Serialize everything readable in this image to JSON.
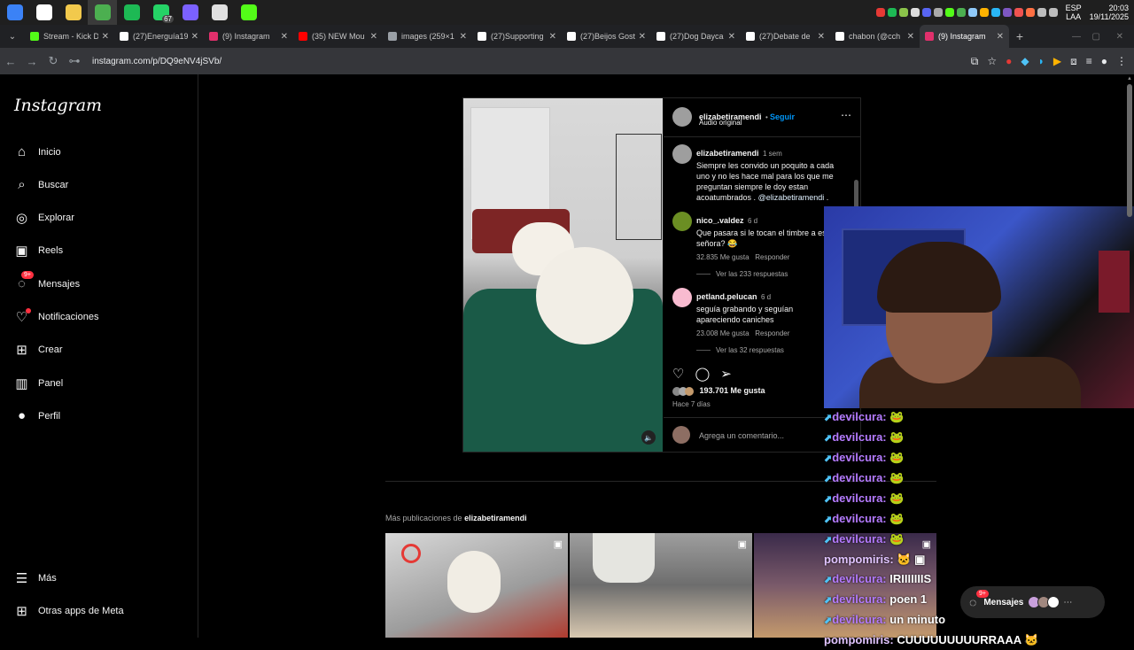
{
  "taskbar": {
    "apps": [
      {
        "name": "windows-start",
        "color": "#3b82f6"
      },
      {
        "name": "search",
        "color": "#ffffff"
      },
      {
        "name": "file-explorer",
        "color": "#f2c94c"
      },
      {
        "name": "chrome",
        "color": "#4caf50"
      },
      {
        "name": "spotify",
        "color": "#1db954"
      },
      {
        "name": "whatsapp",
        "color": "#25d366",
        "badge": "67"
      },
      {
        "name": "messenger",
        "color": "#7b61ff"
      },
      {
        "name": "chatgpt",
        "color": "#e0e0e0"
      },
      {
        "name": "kick",
        "color": "#53fc18"
      }
    ],
    "lang": "ESP",
    "lang_sub": "LAA",
    "time": "20:03",
    "date": "19/11/2025"
  },
  "tabs": [
    {
      "label": "Stream - Kick D",
      "color": "#53fc18"
    },
    {
      "label": "(27)Energuía19",
      "color": "#ffffff"
    },
    {
      "label": "(9) Instagram",
      "color": "#e1306c"
    },
    {
      "label": "(35) NEW Mou",
      "color": "#ff0000"
    },
    {
      "label": "images (259×1",
      "color": "#9aa0a6"
    },
    {
      "label": "(27)Supporting",
      "color": "#ffffff"
    },
    {
      "label": "(27)Beijos Gost",
      "color": "#ffffff"
    },
    {
      "label": "(27)Dog Dayca",
      "color": "#ffffff"
    },
    {
      "label": "(27)Debate de",
      "color": "#ffffff"
    },
    {
      "label": "chabon (@cch",
      "color": "#ffffff"
    },
    {
      "label": "(9) Instagram",
      "color": "#e1306c",
      "active": true
    }
  ],
  "address": {
    "url": "instagram.com/p/DQ9eNV4jSVb/"
  },
  "sidebar": {
    "logo": "Instagram",
    "items": [
      {
        "label": "Inicio",
        "icon": "home-icon",
        "glyph": "⌂"
      },
      {
        "label": "Buscar",
        "icon": "search-icon",
        "glyph": "⌕"
      },
      {
        "label": "Explorar",
        "icon": "compass-icon",
        "glyph": "◎"
      },
      {
        "label": "Reels",
        "icon": "reels-icon",
        "glyph": "▣"
      },
      {
        "label": "Mensajes",
        "icon": "messenger-icon",
        "glyph": "◌",
        "badge": "9+"
      },
      {
        "label": "Notificaciones",
        "icon": "heart-icon",
        "glyph": "♡",
        "dot": true
      },
      {
        "label": "Crear",
        "icon": "plus-icon",
        "glyph": "⊞"
      },
      {
        "label": "Panel",
        "icon": "dashboard-icon",
        "glyph": "▥"
      },
      {
        "label": "Perfil",
        "icon": "profile-avatar",
        "glyph": "●"
      }
    ],
    "more": "Más",
    "meta": "Otras apps de Meta"
  },
  "post": {
    "username": "elizabetiramendi",
    "follow": "Seguir",
    "audio": "Audio original",
    "caption_user": "elizabetiramendi",
    "caption_time": "1 sem",
    "caption_text": "Siempre les convido un poquito a cada uno y no les hace mal para los que me preguntan  siempre le doy estan acoatumbrados .",
    "caption_mention": "@elizabetiramendi",
    "caption_end": ".",
    "comments": [
      {
        "user": "nico_.valdez",
        "time": "6 d",
        "text": "Que pasara si le tocan el timbre a esa señora? 😂",
        "likes": "32.835 Me gusta",
        "reply": "Responder",
        "replies": "Ver las 233 respuestas"
      },
      {
        "user": "petland.pelucan",
        "time": "6 d",
        "text": "seguía grabando y seguían apareciendo caniches",
        "likes": "23.008 Me gusta",
        "reply": "Responder",
        "replies": "Ver las 32 respuestas"
      }
    ],
    "likes": "193.701 Me gusta",
    "ago": "Hace 7 días",
    "comment_placeholder": "Agrega un comentario..."
  },
  "more_posts": {
    "prefix": "Más publicaciones de",
    "user": "elizabetiramendi"
  },
  "chat": [
    {
      "user": "devilcura:",
      "msg": "🐸"
    },
    {
      "user": "devilcura:",
      "msg": "🐸"
    },
    {
      "user": "devilcura:",
      "msg": "🐸"
    },
    {
      "user": "devilcura:",
      "msg": "🐸"
    },
    {
      "user": "devilcura:",
      "msg": "🐸"
    },
    {
      "user": "devilcura:",
      "msg": "🐸"
    },
    {
      "user": "devilcura:",
      "msg": "🐸"
    },
    {
      "user": "pompomiris:",
      "msg": "🐱 ▣"
    },
    {
      "user": "devilcura:",
      "msg": "IRIIIIIIIS"
    },
    {
      "user": "devilcura:",
      "msg": "poen 1"
    },
    {
      "user": "devilcura:",
      "msg": "un minuto"
    },
    {
      "user": "pompomiris:",
      "msg": "CUUUUUUUUURRAAA 🐱"
    }
  ],
  "messages_bar": {
    "label": "Mensajes",
    "badge": "9+"
  }
}
